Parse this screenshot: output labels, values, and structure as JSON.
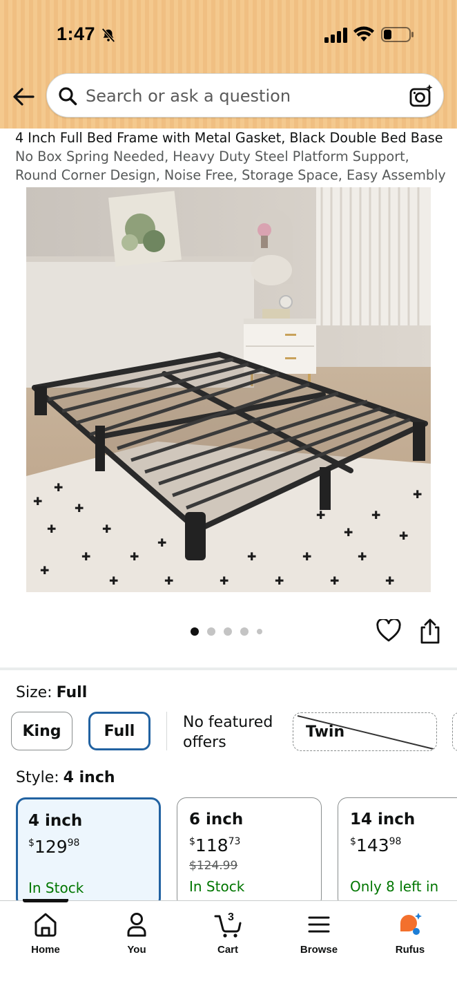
{
  "status_bar": {
    "time": "1:47",
    "icons": [
      "bell-slash-icon",
      "cellular-signal-icon",
      "wifi-icon",
      "battery-icon"
    ]
  },
  "header": {
    "back_icon": "arrow-left-icon",
    "search": {
      "placeholder": "Search or ask a question",
      "search_icon": "magnifier-icon",
      "camera_icon": "camera-lens-icon"
    }
  },
  "product": {
    "title_lines": [
      "4 Inch Full Bed Frame with Metal Gasket, Black Double Bed Base",
      "No Box Spring Needed, Heavy Duty Steel Platform Support,",
      "Round Corner Design, Noise Free, Storage Space, Easy Assembly"
    ],
    "image_description_icon": "bed-frame-image",
    "carousel": {
      "count": 5,
      "active": 1
    },
    "actions": [
      "heart-icon",
      "share-icon"
    ]
  },
  "size": {
    "label": "Size:",
    "selected": "Full",
    "options": [
      {
        "label": "King",
        "state": "available"
      },
      {
        "label": "Full",
        "state": "selected"
      },
      {
        "label": "Twin",
        "state": "unavailable"
      }
    ],
    "no_offers_text": "No featured offers"
  },
  "style": {
    "label": "Style:",
    "selected": "4 inch",
    "options": [
      {
        "name": "4 inch",
        "currency": "$",
        "dollars": "129",
        "cents": "98",
        "list_price": "",
        "stock": "In Stock",
        "selected": true
      },
      {
        "name": "6 inch",
        "currency": "$",
        "dollars": "118",
        "cents": "73",
        "list_price": "$124.99",
        "stock": "In Stock",
        "selected": false
      },
      {
        "name": "14 inch",
        "currency": "$",
        "dollars": "143",
        "cents": "98",
        "list_price": "",
        "stock": "Only 8 left in",
        "selected": false
      }
    ]
  },
  "bottom_nav": {
    "items": [
      {
        "label": "Home",
        "icon": "home-icon",
        "active": true
      },
      {
        "label": "You",
        "icon": "person-icon",
        "active": false
      },
      {
        "label": "Cart",
        "icon": "cart-icon",
        "badge": "3",
        "active": false
      },
      {
        "label": "Browse",
        "icon": "menu-icon",
        "active": false
      },
      {
        "label": "Rufus",
        "icon": "rufus-icon",
        "active": false
      }
    ]
  },
  "colors": {
    "header_bg": "#f4c98e",
    "selected_border": "#2162a1",
    "selected_card_bg": "#edf6fd",
    "in_stock": "#007600",
    "rufus_orange": "#f3702d",
    "rufus_blue": "#1c7ed6"
  }
}
